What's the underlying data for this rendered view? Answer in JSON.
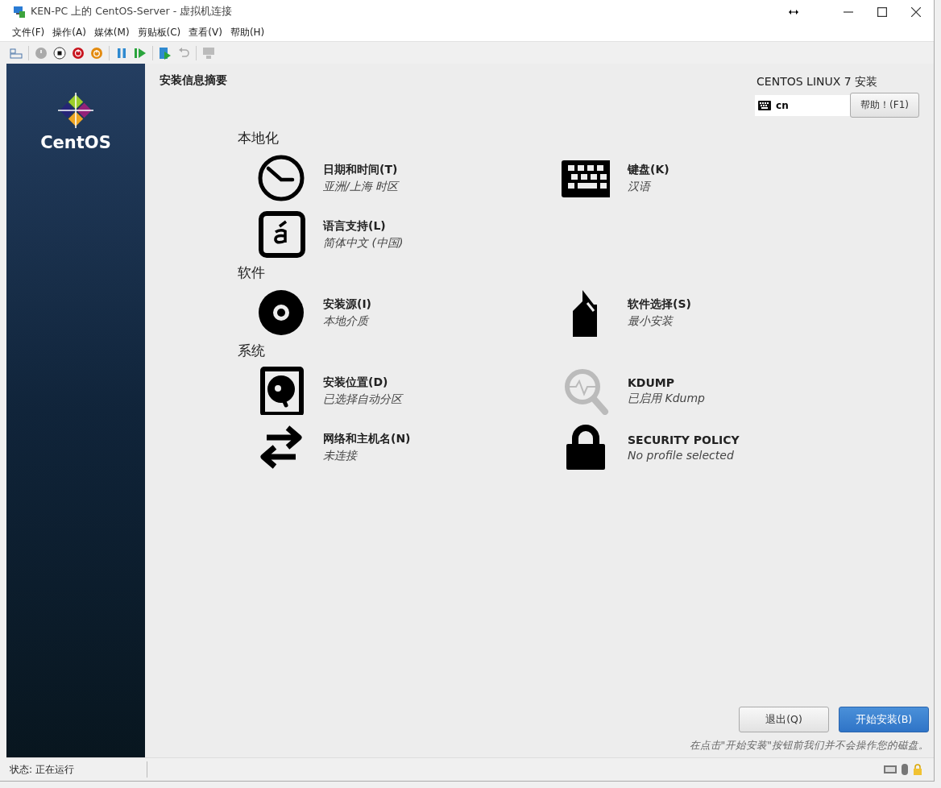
{
  "window": {
    "title": "KEN-PC 上的 CentOS-Server - 虚拟机连接"
  },
  "menu": [
    "文件(F)",
    "操作(A)",
    "媒体(M)",
    "剪贴板(C)",
    "查看(V)",
    "帮助(H)"
  ],
  "installer": {
    "logo_text": "CentOS",
    "page_title": "安装信息摘要",
    "product": "CENTOS LINUX 7 安装",
    "keyboard_layout": "cn",
    "help_button": "帮助！(F1)",
    "sections": [
      {
        "title": "本地化",
        "items": [
          {
            "label": "日期和时间(T)",
            "status": "亚洲/上海 时区",
            "dimmed": false
          },
          {
            "label": "键盘(K)",
            "status": "汉语",
            "dimmed": false
          },
          {
            "label": "语言支持(L)",
            "status": "简体中文 (中国)",
            "dimmed": false
          }
        ]
      },
      {
        "title": "软件",
        "items": [
          {
            "label": "安装源(I)",
            "status": "本地介质",
            "dimmed": false
          },
          {
            "label": "软件选择(S)",
            "status": "最小安装",
            "dimmed": false
          }
        ]
      },
      {
        "title": "系统",
        "items": [
          {
            "label": "安装位置(D)",
            "status": "已选择自动分区",
            "dimmed": false
          },
          {
            "label": "KDUMP",
            "status": "已启用 Kdump",
            "dimmed": true
          },
          {
            "label": "网络和主机名(N)",
            "status": "未连接",
            "dimmed": false
          },
          {
            "label": "SECURITY POLICY",
            "status": "No profile selected",
            "dimmed": false
          }
        ]
      }
    ],
    "quit_button": "退出(Q)",
    "begin_button": "开始安装(B)",
    "note": "在点击\"开始安装\"按钮前我们并不会操作您的磁盘。"
  },
  "status_bar": {
    "text": "状态: 正在运行"
  }
}
